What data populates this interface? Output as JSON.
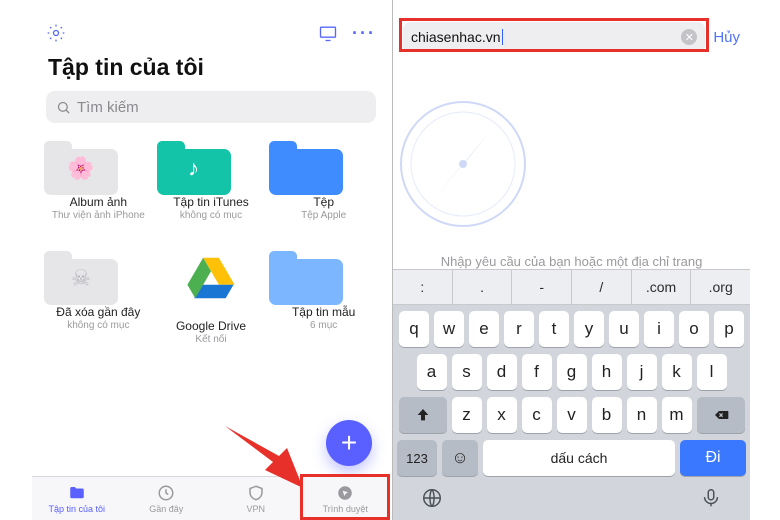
{
  "left": {
    "title": "Tập tin của tôi",
    "search_placeholder": "Tìm kiếm",
    "tiles": [
      {
        "label": "Album ảnh",
        "sub": "Thư viện ảnh iPhone"
      },
      {
        "label": "Tập tin iTunes",
        "sub": "không có mục"
      },
      {
        "label": "Tệp",
        "sub": "Tệp Apple"
      },
      {
        "label": "Đã xóa gần đây",
        "sub": "không có mục"
      },
      {
        "label": "Google Drive",
        "sub": "Kết nối"
      },
      {
        "label": "Tập tin mẫu",
        "sub": "6 mục"
      }
    ],
    "tabs": [
      {
        "label": "Tập tin của tôi"
      },
      {
        "label": "Gần đây"
      },
      {
        "label": "VPN"
      },
      {
        "label": "Trình duyệt"
      }
    ],
    "fab": "+"
  },
  "right": {
    "url": "chiasenhac.vn",
    "cancel": "Hủy",
    "placeholder": "Nhập yêu cầu của bạn hoặc một địa chỉ trang web",
    "kb_top": [
      ":",
      ".",
      "-",
      "/",
      ".com",
      ".org"
    ],
    "rows": [
      [
        "q",
        "w",
        "e",
        "r",
        "t",
        "y",
        "u",
        "i",
        "o",
        "p"
      ],
      [
        "a",
        "s",
        "d",
        "f",
        "g",
        "h",
        "j",
        "k",
        "l"
      ],
      [
        "z",
        "x",
        "c",
        "v",
        "b",
        "n",
        "m"
      ]
    ],
    "numkey": "123",
    "space": "dấu cách",
    "go": "Đi"
  }
}
